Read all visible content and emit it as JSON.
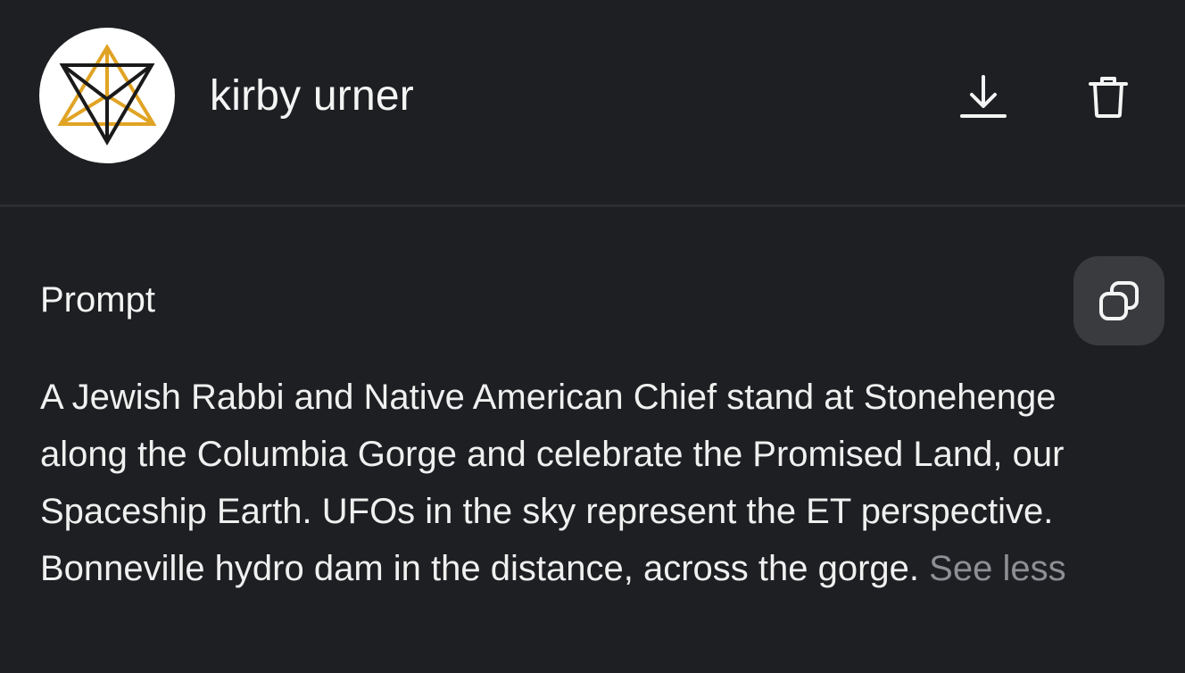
{
  "header": {
    "avatar_icon": "star-tetrahedron-logo-icon",
    "username": "kirby urner",
    "download_icon": "download-icon",
    "delete_icon": "trash-icon"
  },
  "prompt": {
    "label": "Prompt",
    "copy_icon": "copy-icon",
    "text": "A Jewish Rabbi and Native American Chief stand at Stonehenge along the Columbia Gorge and celebrate the Promised Land, our Spaceship Earth. UFOs in the sky represent the ET perspective. Bonneville hydro dam in the distance, across the gorge.",
    "toggle_label": "See less"
  },
  "colors": {
    "background": "#1e1f22",
    "divider": "#2c2d31",
    "copy_button_bg": "#3a3b3f",
    "text_primary": "#f0f0f0",
    "text_muted": "#8e8f94",
    "logo_gold": "#e0a324",
    "logo_dark": "#1a1a1a"
  }
}
